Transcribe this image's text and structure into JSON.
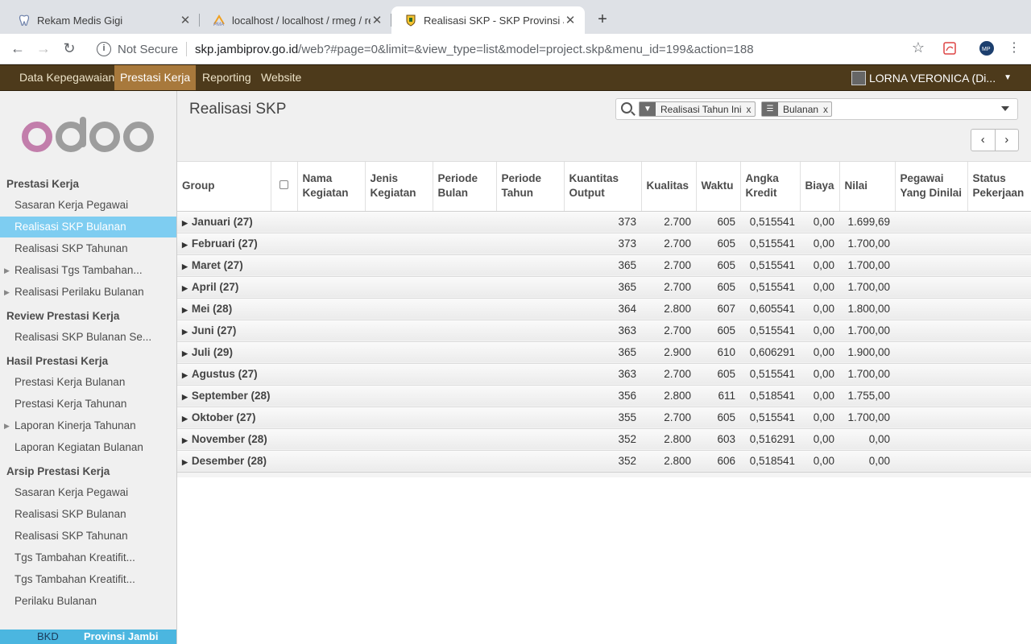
{
  "browser": {
    "tabs": [
      {
        "title": "Rekam Medis Gigi",
        "favicon": "tooth-icon"
      },
      {
        "title": "localhost / localhost / rmeg / re",
        "favicon": "pma-icon"
      },
      {
        "title": "Realisasi SKP - SKP Provinsi Ja",
        "favicon": "jambi-crest-icon",
        "active": true
      }
    ],
    "new_tab_symbol": "+",
    "security_label": "Not Secure",
    "url_domain": "skp.jambiprov.go.id",
    "url_path": "/web?#page=0&limit=&view_type=list&model=project.skp&menu_id=199&action=188"
  },
  "topmenu": {
    "items": [
      "Data Kepegawaian",
      "Prestasi Kerja",
      "Reporting",
      "Website"
    ],
    "active": "Prestasi Kerja",
    "user": "LORNA VERONICA (Di...",
    "accent": "#4d3a1b",
    "active_color": "#a8793c"
  },
  "sidebar": {
    "logo": "odoo",
    "sections": [
      {
        "title": "Prestasi Kerja",
        "items": [
          {
            "label": "Sasaran Kerja Pegawai"
          },
          {
            "label": "Realisasi SKP Bulanan",
            "active": true
          },
          {
            "label": "Realisasi SKP Tahunan"
          },
          {
            "label": "Realisasi Tgs Tambahan...",
            "expandable": true
          },
          {
            "label": "Realisasi Perilaku Bulanan",
            "expandable": true
          }
        ]
      },
      {
        "title": "Review Prestasi Kerja",
        "items": [
          {
            "label": "Realisasi SKP Bulanan Se..."
          }
        ]
      },
      {
        "title": "Hasil Prestasi Kerja",
        "items": [
          {
            "label": "Prestasi Kerja Bulanan"
          },
          {
            "label": "Prestasi Kerja Tahunan"
          },
          {
            "label": "Laporan Kinerja Tahunan",
            "expandable": true
          },
          {
            "label": "Laporan Kegiatan Bulanan"
          }
        ]
      },
      {
        "title": "Arsip Prestasi Kerja",
        "items": [
          {
            "label": "Sasaran Kerja Pegawai"
          },
          {
            "label": "Realisasi SKP Bulanan"
          },
          {
            "label": "Realisasi SKP Tahunan"
          },
          {
            "label": "Tgs Tambahan Kreatifit..."
          },
          {
            "label": "Tgs Tambahan Kreatifit..."
          },
          {
            "label": "Perilaku Bulanan"
          }
        ]
      }
    ],
    "footer_bkd": "BKD",
    "footer_prov": "Provinsi Jambi"
  },
  "view": {
    "title": "Realisasi SKP",
    "facets": [
      {
        "icon": "filter-icon",
        "label": "Realisasi Tahun Ini"
      },
      {
        "icon": "group-by-icon",
        "label": "Bulanan"
      }
    ],
    "facet_remove": "x"
  },
  "table": {
    "columns": [
      "Group",
      "",
      "Nama Kegiatan",
      "Jenis Kegiatan",
      "Periode Bulan",
      "Periode Tahun",
      "Kuantitas Output",
      "Kualitas",
      "Waktu",
      "Angka Kredit",
      "Biaya",
      "Nilai",
      "Pegawai Yang Dinilai",
      "Status Pekerjaan"
    ],
    "rows": [
      {
        "group": "Januari (27)",
        "kuantitas": "373",
        "kualitas": "2.700",
        "waktu": "605",
        "angka_kredit": "0,515541",
        "biaya": "0,00",
        "nilai": "1.699,69"
      },
      {
        "group": "Februari (27)",
        "kuantitas": "373",
        "kualitas": "2.700",
        "waktu": "605",
        "angka_kredit": "0,515541",
        "biaya": "0,00",
        "nilai": "1.700,00"
      },
      {
        "group": "Maret (27)",
        "kuantitas": "365",
        "kualitas": "2.700",
        "waktu": "605",
        "angka_kredit": "0,515541",
        "biaya": "0,00",
        "nilai": "1.700,00"
      },
      {
        "group": "April (27)",
        "kuantitas": "365",
        "kualitas": "2.700",
        "waktu": "605",
        "angka_kredit": "0,515541",
        "biaya": "0,00",
        "nilai": "1.700,00"
      },
      {
        "group": "Mei (28)",
        "kuantitas": "364",
        "kualitas": "2.800",
        "waktu": "607",
        "angka_kredit": "0,605541",
        "biaya": "0,00",
        "nilai": "1.800,00"
      },
      {
        "group": "Juni (27)",
        "kuantitas": "363",
        "kualitas": "2.700",
        "waktu": "605",
        "angka_kredit": "0,515541",
        "biaya": "0,00",
        "nilai": "1.700,00"
      },
      {
        "group": "Juli (29)",
        "kuantitas": "365",
        "kualitas": "2.900",
        "waktu": "610",
        "angka_kredit": "0,606291",
        "biaya": "0,00",
        "nilai": "1.900,00"
      },
      {
        "group": "Agustus (27)",
        "kuantitas": "363",
        "kualitas": "2.700",
        "waktu": "605",
        "angka_kredit": "0,515541",
        "biaya": "0,00",
        "nilai": "1.700,00"
      },
      {
        "group": "September (28)",
        "kuantitas": "356",
        "kualitas": "2.800",
        "waktu": "611",
        "angka_kredit": "0,518541",
        "biaya": "0,00",
        "nilai": "1.755,00"
      },
      {
        "group": "Oktober (27)",
        "kuantitas": "355",
        "kualitas": "2.700",
        "waktu": "605",
        "angka_kredit": "0,515541",
        "biaya": "0,00",
        "nilai": "1.700,00"
      },
      {
        "group": "November (28)",
        "kuantitas": "352",
        "kualitas": "2.800",
        "waktu": "603",
        "angka_kredit": "0,516291",
        "biaya": "0,00",
        "nilai": "0,00"
      },
      {
        "group": "Desember (28)",
        "kuantitas": "352",
        "kualitas": "2.800",
        "waktu": "606",
        "angka_kredit": "0,518541",
        "biaya": "0,00",
        "nilai": "0,00"
      }
    ]
  }
}
